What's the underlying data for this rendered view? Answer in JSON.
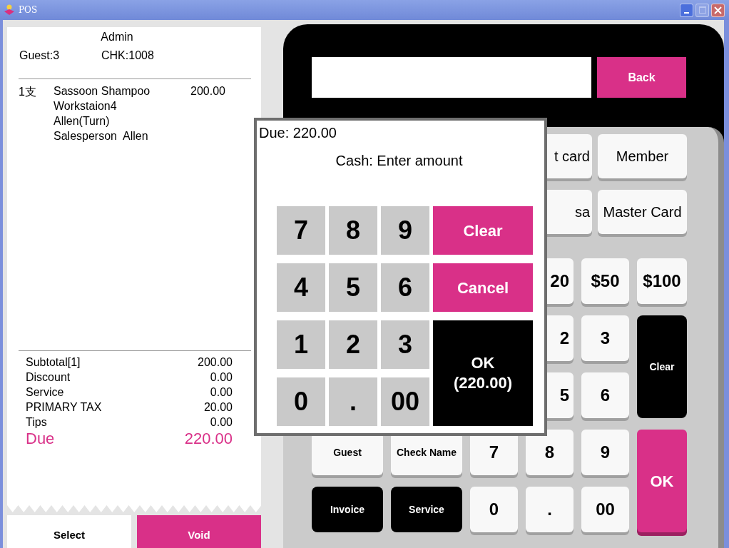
{
  "window": {
    "title": "POS"
  },
  "receipt": {
    "user": "Admin",
    "guest": "Guest:3",
    "check": "CHK:1008",
    "items": [
      {
        "qty": "1支",
        "name": "Sassoon Shampoo",
        "price": "200.00",
        "details": [
          "Workstaion4",
          "Allen(Turn)",
          "Salesperson  Allen"
        ]
      }
    ],
    "totals": [
      {
        "label": "Subtotal[1]",
        "value": "200.00",
        "kind": "line"
      },
      {
        "label": "Discount",
        "value": "0.00",
        "kind": "line"
      },
      {
        "label": "Service",
        "value": "0.00",
        "kind": "line"
      },
      {
        "label": "PRIMARY TAX",
        "value": "20.00",
        "kind": "line"
      },
      {
        "label": "Tips",
        "value": "0.00",
        "kind": "line"
      },
      {
        "label": "Due",
        "value": "220.00",
        "kind": "due"
      }
    ]
  },
  "receipt_buttons": [
    {
      "label": "Select",
      "kind": "light"
    },
    {
      "label": "Void",
      "kind": "accent"
    }
  ],
  "pad": {
    "back": "Back",
    "tender_rows": [
      [
        "t card",
        "Member"
      ],
      [
        "sa",
        "Master Card"
      ]
    ],
    "keys": [
      {
        "label": "20",
        "kind": "light"
      },
      {
        "label": "$50",
        "kind": "light"
      },
      {
        "label": "$100",
        "kind": "light"
      },
      {
        "label": "2",
        "kind": "light"
      },
      {
        "label": "3",
        "kind": "light"
      },
      {
        "label": "Clear",
        "kind": "dark"
      },
      {
        "label": "5",
        "kind": "light"
      },
      {
        "label": "6",
        "kind": "light"
      },
      {
        "label": "Guest",
        "kind": "light"
      },
      {
        "label": "Check Name",
        "kind": "light"
      },
      {
        "label": "7",
        "kind": "light"
      },
      {
        "label": "8",
        "kind": "light"
      },
      {
        "label": "9",
        "kind": "light"
      },
      {
        "label": "OK",
        "kind": "accent"
      },
      {
        "label": "Invoice",
        "kind": "dark"
      },
      {
        "label": "Service",
        "kind": "dark"
      },
      {
        "label": "0",
        "kind": "light"
      },
      {
        "label": ".",
        "kind": "light"
      },
      {
        "label": "00",
        "kind": "light"
      }
    ]
  },
  "dialog": {
    "due": "Due: 220.00",
    "prompt": "Cash: Enter amount",
    "keys": [
      "7",
      "8",
      "9",
      "4",
      "5",
      "6",
      "1",
      "2",
      "3",
      "0",
      ".",
      "00"
    ],
    "clear": "Clear",
    "cancel": "Cancel",
    "ok": "OK\n(220.00)"
  }
}
